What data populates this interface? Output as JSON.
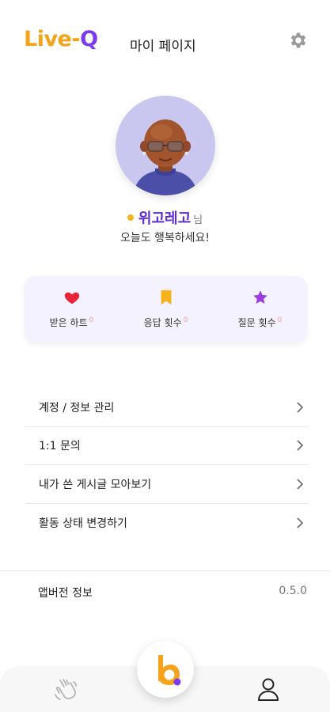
{
  "header": {
    "logo_live": "Live",
    "logo_dash": "-",
    "logo_q": "Q",
    "title": "마이 페이지",
    "settings_icon": "gear-icon"
  },
  "profile": {
    "name": "위고레고",
    "honorific": "님",
    "greeting": "오늘도 행복하세요!",
    "status_color": "#f6b21a"
  },
  "stats": [
    {
      "label": "받은 하트",
      "count": "0",
      "icon": "heart-icon"
    },
    {
      "label": "응답 횟수",
      "count": "0",
      "icon": "bookmark-icon"
    },
    {
      "label": "질문 횟수",
      "count": "0",
      "icon": "star-icon"
    }
  ],
  "menu": [
    {
      "label": "계정 / 정보 관리"
    },
    {
      "label": "1:1 문의"
    },
    {
      "label": "내가 쓴 게시글 모아보기"
    },
    {
      "label": "활동 상태 변경하기"
    }
  ],
  "version": {
    "label": "앱버전 정보",
    "value": "0.5.0"
  },
  "bottom_nav": {
    "left_icon": "waving-hand-icon",
    "center_icon": "app-logo-icon",
    "right_icon": "profile-icon"
  },
  "colors": {
    "brand_orange": "#f6a21a",
    "brand_purple": "#7c3aed",
    "heart_red": "#e8243a",
    "bookmark_yellow": "#f6b21a",
    "star_purple": "#9b3ee0"
  }
}
